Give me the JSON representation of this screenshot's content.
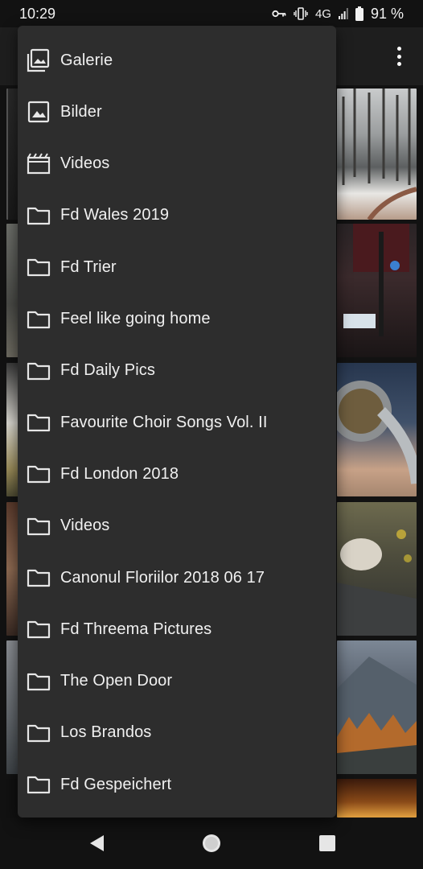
{
  "status_bar": {
    "time": "10:29",
    "network": "4G",
    "battery": "91 %",
    "icons": [
      "vpn-key-icon",
      "vibrate-icon",
      "signal-icon",
      "battery-icon"
    ]
  },
  "app_bar": {
    "overflow_icon": "more-vert-icon"
  },
  "menu": {
    "items": [
      {
        "label": "Galerie",
        "icon": "gallery-icon"
      },
      {
        "label": "Bilder",
        "icon": "image-icon"
      },
      {
        "label": "Videos",
        "icon": "video-icon"
      },
      {
        "label": "Fd Wales 2019",
        "icon": "folder-icon"
      },
      {
        "label": "Fd Trier",
        "icon": "folder-icon"
      },
      {
        "label": "Feel like going home",
        "icon": "folder-icon"
      },
      {
        "label": "Fd Daily Pics",
        "icon": "folder-icon"
      },
      {
        "label": "Favourite Choir Songs Vol. II",
        "icon": "folder-icon"
      },
      {
        "label": "Fd London 2018",
        "icon": "folder-icon"
      },
      {
        "label": "Videos",
        "icon": "folder-icon"
      },
      {
        "label": "Canonul Floriilor 2018 06 17",
        "icon": "folder-icon"
      },
      {
        "label": "Fd Threema Pictures",
        "icon": "folder-icon"
      },
      {
        "label": "The Open Door",
        "icon": "folder-icon"
      },
      {
        "label": "Los Brandos",
        "icon": "folder-icon"
      },
      {
        "label": "Fd Gespeichert",
        "icon": "folder-icon"
      }
    ]
  },
  "nav_bar": {
    "back": "back-icon",
    "home": "home-icon",
    "recents": "recents-icon"
  }
}
